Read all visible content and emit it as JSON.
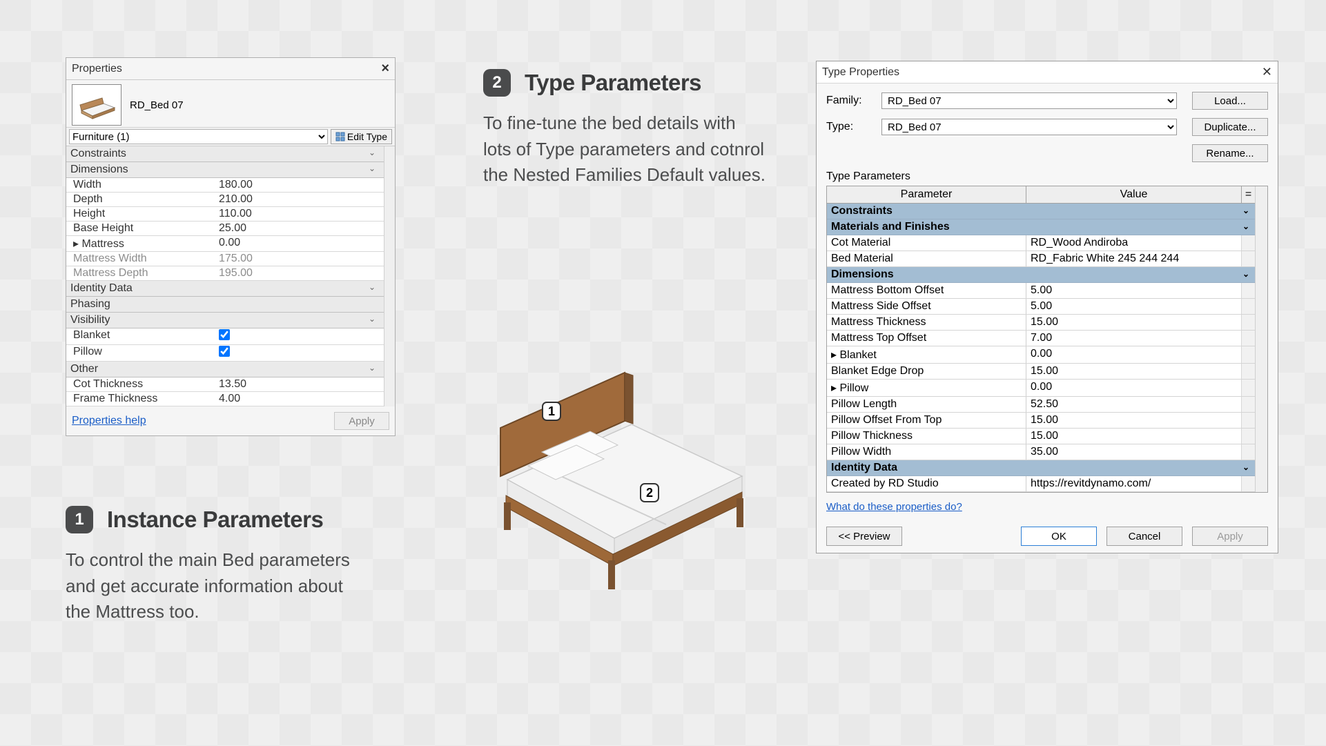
{
  "anno1": {
    "badge": "1",
    "title": "Instance Parameters",
    "body": "To control the main Bed parameters and get accurate information about the Mattress too."
  },
  "anno2": {
    "badge": "2",
    "title": "Type Parameters",
    "body": "To fine-tune the bed details with lots of Type parameters and cotnrol the Nested Families Default values."
  },
  "prop": {
    "title": "Properties",
    "type_name": "RD_Bed 07",
    "category": "Furniture (1)",
    "edit_type": "Edit Type",
    "groups": {
      "constraints": "Constraints",
      "dimensions": "Dimensions",
      "identity": "Identity Data",
      "phasing": "Phasing",
      "visibility": "Visibility",
      "other": "Other"
    },
    "dims": {
      "width_k": "Width",
      "width_v": "180.00",
      "depth_k": "Depth",
      "depth_v": "210.00",
      "height_k": "Height",
      "height_v": "110.00",
      "base_k": "Base Height",
      "base_v": "25.00",
      "mat_k": "▸ Mattress",
      "mat_v": "0.00",
      "mw_k": "Mattress Width",
      "mw_v": "175.00",
      "md_k": "Mattress Depth",
      "md_v": "195.00"
    },
    "vis": {
      "blanket": "Blanket",
      "pillow": "Pillow"
    },
    "other": {
      "cot_k": "Cot Thickness",
      "cot_v": "13.50",
      "ft_k": "Frame Thickness",
      "ft_v": "4.00"
    },
    "help": "Properties help",
    "apply": "Apply"
  },
  "dlg": {
    "title": "Type Properties",
    "family_l": "Family:",
    "family_v": "RD_Bed 07",
    "type_l": "Type:",
    "type_v": "RD_Bed 07",
    "load": "Load...",
    "dup": "Duplicate...",
    "ren": "Rename...",
    "tp_label": "Type Parameters",
    "hdr_param": "Parameter",
    "hdr_value": "Value",
    "cats": {
      "constraints": "Constraints",
      "mat": "Materials and Finishes",
      "dims": "Dimensions",
      "id": "Identity Data"
    },
    "mat": {
      "cot_k": "Cot Material",
      "cot_v": "RD_Wood Andiroba",
      "bed_k": "Bed Material",
      "bed_v": "RD_Fabric White 245 244 244"
    },
    "dims": {
      "mbo_k": "Mattress Bottom Offset",
      "mbo_v": "5.00",
      "mso_k": "Mattress Side Offset",
      "mso_v": "5.00",
      "mt_k": "Mattress Thickness",
      "mt_v": "15.00",
      "mto_k": "Mattress Top Offset",
      "mto_v": "7.00",
      "bl_k": "▸ Blanket",
      "bl_v": "0.00",
      "bed_k": "Blanket Edge Drop",
      "bed_v": "15.00",
      "pl_k": "▸ Pillow",
      "pl_v": "0.00",
      "plen_k": "Pillow Length",
      "plen_v": "52.50",
      "poft_k": "Pillow Offset From Top",
      "poft_v": "15.00",
      "pth_k": "Pillow Thickness",
      "pth_v": "15.00",
      "pw_k": "Pillow Width",
      "pw_v": "35.00"
    },
    "id": {
      "crb_k": "Created by RD Studio",
      "crb_v": "https://revitdynamo.com/"
    },
    "help": "What do these properties do?",
    "preview": "<< Preview",
    "ok": "OK",
    "cancel": "Cancel",
    "apply": "Apply"
  },
  "bed": {
    "b1": "1",
    "b2": "2"
  }
}
